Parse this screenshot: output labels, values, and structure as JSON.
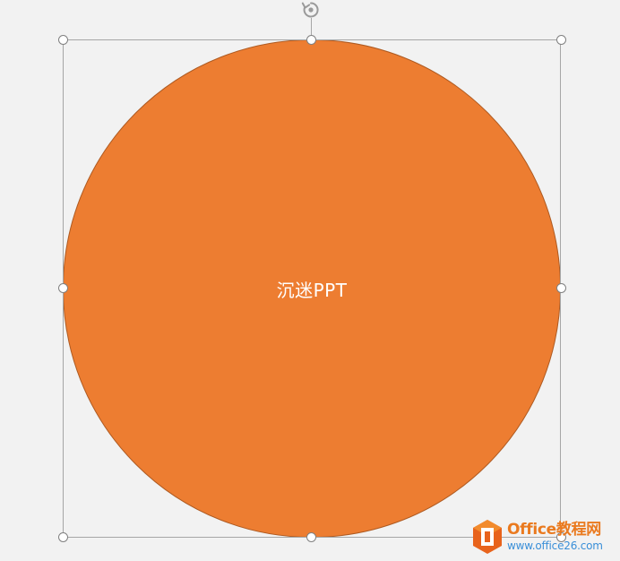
{
  "slide": {
    "background_color": "#f2f2f2"
  },
  "shape": {
    "type": "circle",
    "fill_color": "#ed7d31",
    "outline_color": "#ae5a21",
    "text": "沉迷PPT",
    "text_color": "#ffffff",
    "selected": true
  },
  "selection": {
    "border_color": "#a6a6a6",
    "handle_icon": "resize-handle-icon",
    "rotate_icon": "rotate-icon"
  },
  "watermark": {
    "logo_icon": "office-logo-icon",
    "title": "Office教程网",
    "url": "www.office26.com",
    "title_color": "#ea7a1f",
    "url_color": "#3a8fd8"
  }
}
